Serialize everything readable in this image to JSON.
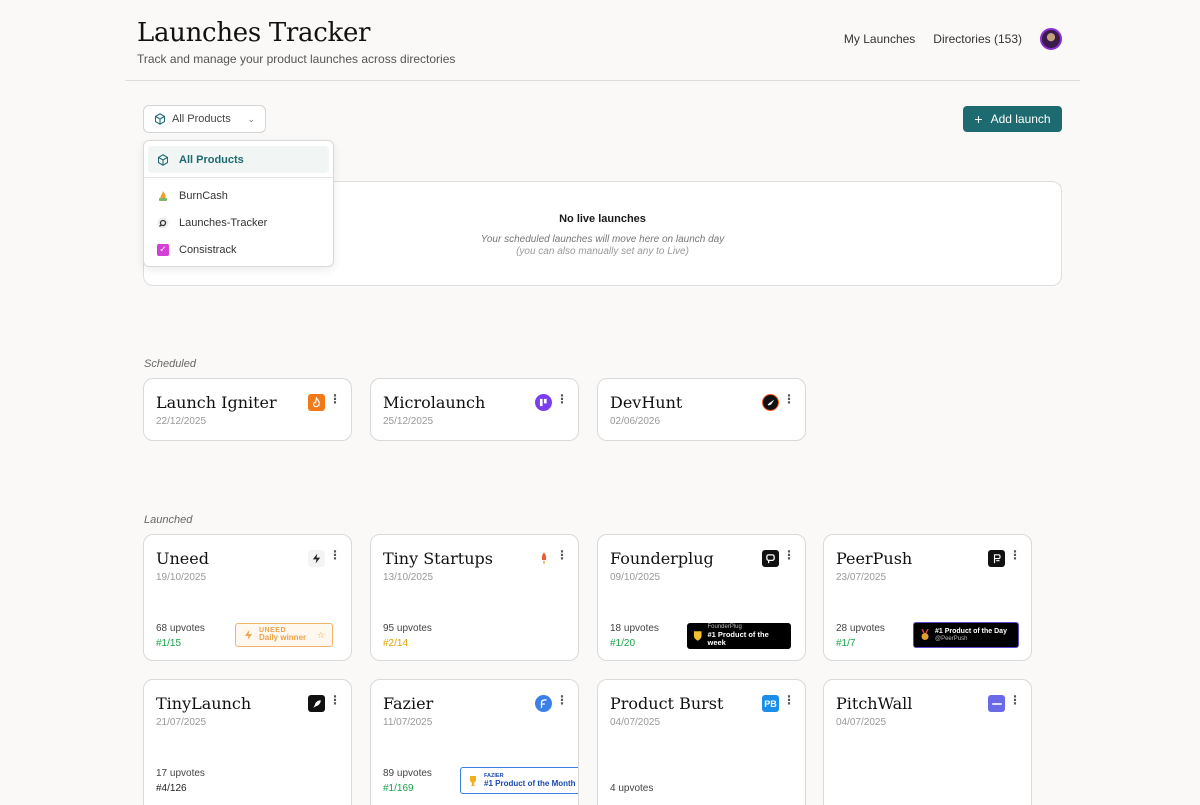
{
  "app": {
    "title": "Launches Tracker",
    "subtitle": "Track and manage your product launches across directories"
  },
  "nav": {
    "my_launches": "My Launches",
    "directories": "Directories (153)"
  },
  "filter": {
    "selected": "All Products"
  },
  "add_button": "Add launch",
  "dropdown": {
    "items": [
      {
        "label": "All Products",
        "icon": "cube-icon"
      },
      {
        "label": "BurnCash",
        "icon": "burncash-logo"
      },
      {
        "label": "Launches-Tracker",
        "icon": "launches-tracker-logo"
      },
      {
        "label": "Consistrack",
        "icon": "checkbox-icon"
      }
    ]
  },
  "live": {
    "title": "No live launches",
    "subtitle": "Your scheduled launches will move here on launch day",
    "note": "(you can also manually set any to Live)"
  },
  "sections": {
    "scheduled": "Scheduled",
    "launched": "Launched"
  },
  "scheduled": [
    {
      "name": "Launch Igniter",
      "date": "22/12/2025",
      "icon_color": "#f07a1a"
    },
    {
      "name": "Microlaunch",
      "date": "25/12/2025",
      "icon_color": "#7a3ef0"
    },
    {
      "name": "DevHunt",
      "date": "02/06/2026",
      "icon_color": "#111111"
    }
  ],
  "launched": [
    {
      "name": "Uneed",
      "date": "19/10/2025",
      "upvotes": "68 upvotes",
      "rank": "#1/15",
      "rank_color": "#1aa34a",
      "badge": {
        "line1": "UNEED",
        "line2": "Daily winner"
      }
    },
    {
      "name": "Tiny Startups",
      "date": "13/10/2025",
      "upvotes": "95 upvotes",
      "rank": "#2/14",
      "rank_color": "#e0a400"
    },
    {
      "name": "Founderplug",
      "date": "09/10/2025",
      "upvotes": "18 upvotes",
      "rank": "#1/20",
      "rank_color": "#1aa34a",
      "badge": {
        "line1": "FounderPlug",
        "line2": "#1 Product of the week"
      }
    },
    {
      "name": "PeerPush",
      "date": "23/07/2025",
      "upvotes": "28 upvotes",
      "rank": "#1/7",
      "rank_color": "#1aa34a",
      "badge": {
        "line1": "#1 Product of the Day",
        "line2": "@PeerPush"
      }
    },
    {
      "name": "TinyLaunch",
      "date": "21/07/2025",
      "upvotes": "17 upvotes",
      "rank": "#4/126",
      "rank_color": "#222222"
    },
    {
      "name": "Fazier",
      "date": "11/07/2025",
      "upvotes": "89 upvotes",
      "rank": "#1/169",
      "rank_color": "#1aa34a",
      "badge": {
        "line1": "FAZIER",
        "line2": "#1 Product of the Month"
      }
    },
    {
      "name": "Product Burst",
      "date": "04/07/2025",
      "upvotes": "4 upvotes"
    },
    {
      "name": "PitchWall",
      "date": "04/07/2025"
    }
  ],
  "icons": {
    "productburst": "PB"
  }
}
